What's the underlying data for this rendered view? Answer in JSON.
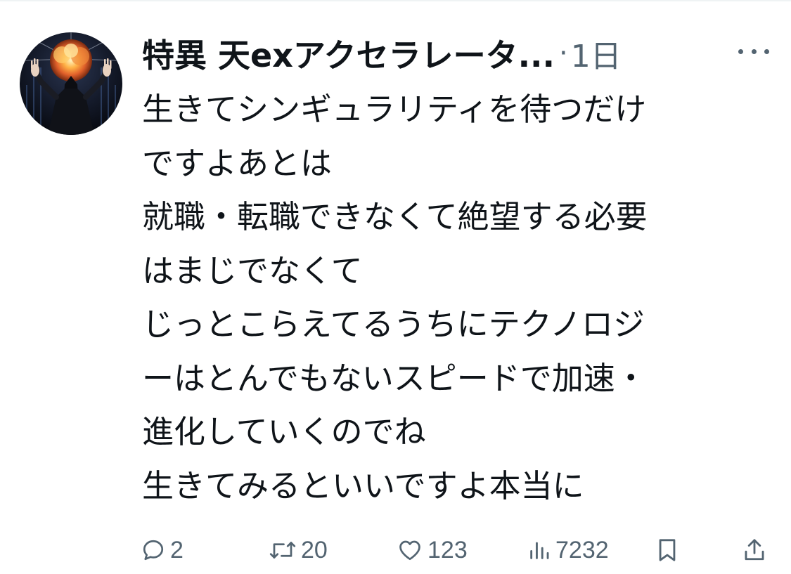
{
  "post": {
    "display_name": "特異 天exアクセラレータ...",
    "separator": "·",
    "timestamp": "1日",
    "body_lines": [
      "生きてシンギュラリティを待つだけ",
      "ですよあとは",
      "就職・転職できなくて絶望する必要",
      "はまじでなくて",
      "じっとこらえてるうちにテクノロジ",
      "ーはとんでもないスピードで加速・",
      "進化していくのでね",
      "生きてみるといいですよ本当に"
    ]
  },
  "actions": {
    "replies": "2",
    "reposts": "20",
    "likes": "123",
    "views": "7232"
  },
  "icons": {
    "reply": "reply-icon",
    "repost": "repost-icon",
    "like": "heart-icon",
    "views": "views-icon",
    "bookmark": "bookmark-icon",
    "share": "share-icon",
    "more": "more-icon"
  },
  "colors": {
    "text": "#0f1419",
    "muted": "#536471"
  }
}
